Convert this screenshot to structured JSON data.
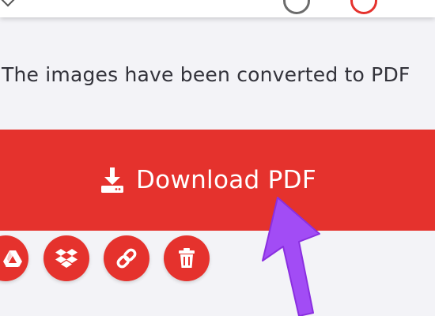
{
  "message": "The images have been converted to PDF",
  "download": {
    "label": "Download PDF",
    "icon": "download-icon"
  },
  "actions": [
    {
      "icon": "google-drive-icon"
    },
    {
      "icon": "dropbox-icon"
    },
    {
      "icon": "link-icon"
    },
    {
      "icon": "trash-icon"
    }
  ],
  "colors": {
    "accent": "#e5322d",
    "background": "#f3f3f7",
    "text": "#33333b",
    "pointer": "#a24cf5"
  }
}
